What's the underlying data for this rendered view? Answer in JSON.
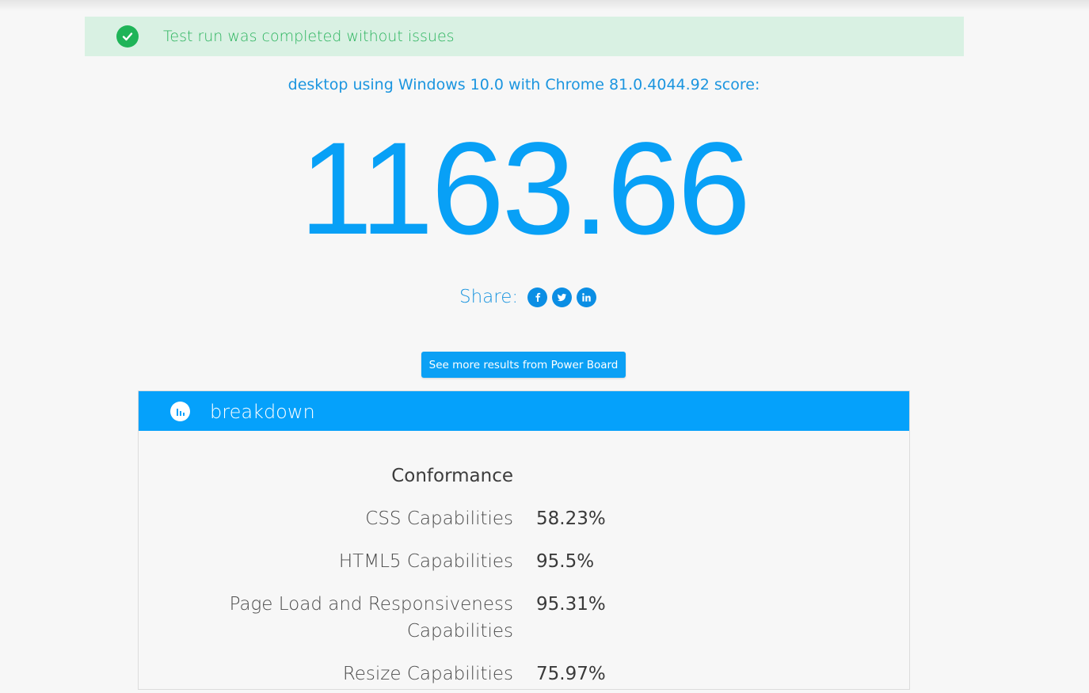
{
  "alert": {
    "message": "Test run was completed without issues",
    "icon": "check-circle-icon",
    "color": "#1fb458"
  },
  "device_line": "desktop using Windows 10.0 with Chrome 81.0.4044.92 score:",
  "score": "1163.66",
  "share": {
    "label": "Share:",
    "icons": [
      "facebook-icon",
      "twitter-icon",
      "linkedin-icon"
    ]
  },
  "powerboard_button": "See more results from Power Board",
  "breakdown": {
    "title": "breakdown",
    "icon": "bar-chart-icon",
    "accent": "#05a1fb",
    "section_heading": "Conformance",
    "rows": [
      {
        "label": "CSS Capabilities",
        "value": "58.23%"
      },
      {
        "label": "HTML5 Capabilities",
        "value": "95.5%"
      },
      {
        "label": "Page Load and Responsiveness Capabilities",
        "value": "95.31%"
      },
      {
        "label": "Resize Capabilities",
        "value": "75.97%"
      }
    ]
  }
}
